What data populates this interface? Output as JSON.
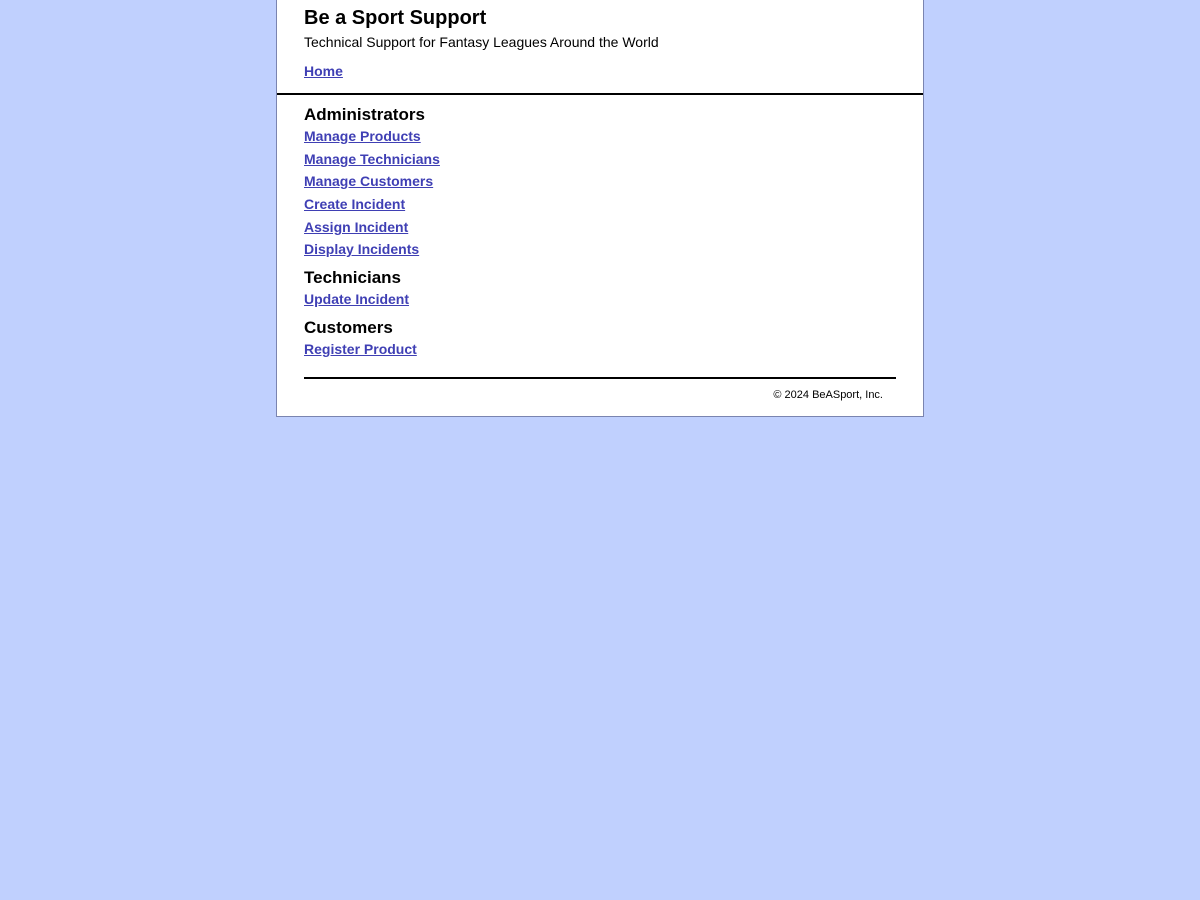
{
  "header": {
    "title": "Be a Sport Support",
    "subtitle": "Technical Support for Fantasy Leagues Around the World",
    "home_link": "Home"
  },
  "sections": {
    "administrators": {
      "heading": "Administrators",
      "links": [
        "Manage Products",
        "Manage Technicians",
        "Manage Customers",
        "Create Incident",
        "Assign Incident",
        "Display Incidents"
      ]
    },
    "technicians": {
      "heading": "Technicians",
      "links": [
        "Update Incident"
      ]
    },
    "customers": {
      "heading": "Customers",
      "links": [
        "Register Product"
      ]
    }
  },
  "footer": {
    "copyright": "© 2024 BeASport, Inc."
  },
  "colors": {
    "background": "#c0d0fe",
    "link": "#3f3fb4",
    "panel": "#ffffff"
  }
}
